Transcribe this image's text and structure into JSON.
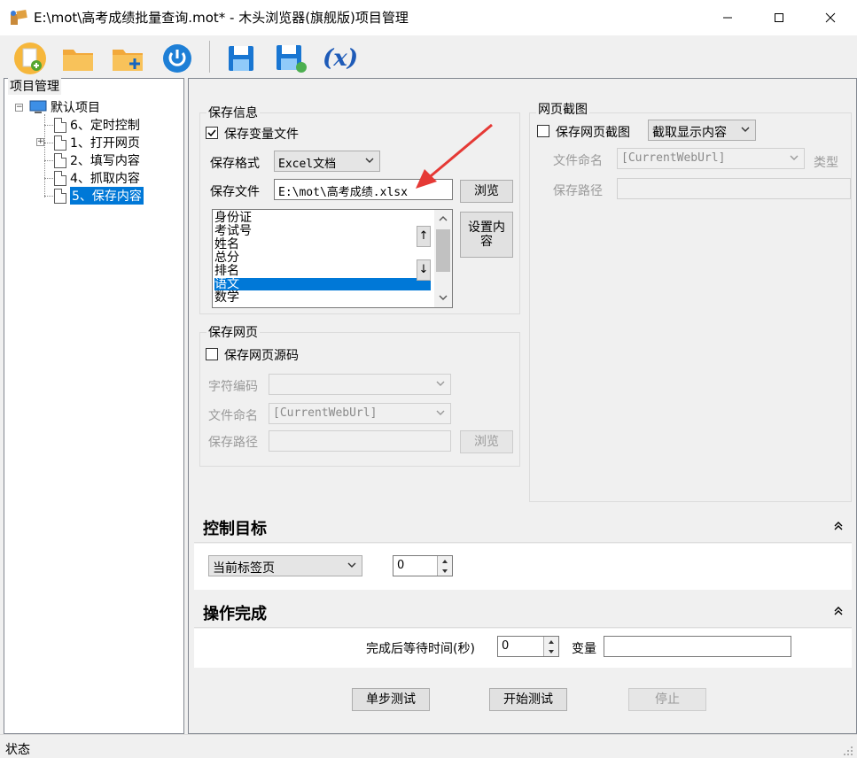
{
  "window": {
    "title": "E:\\mot\\高考成绩批量查询.mot* - 木头浏览器(旗舰版)项目管理"
  },
  "toolbar": {
    "icons": [
      "new-file-icon",
      "open-folder-icon",
      "add-folder-icon",
      "power-icon",
      "save-icon",
      "save-as-icon",
      "variable-icon"
    ],
    "variable_label": "(x)"
  },
  "left_panel": {
    "title": "项目管理",
    "tree": {
      "root": "默认项目",
      "items": [
        {
          "label": "6、定时控制",
          "selected": false,
          "expandable": false
        },
        {
          "label": "1、打开网页",
          "selected": false,
          "expandable": true
        },
        {
          "label": "2、填写内容",
          "selected": false,
          "expandable": false
        },
        {
          "label": "4、抓取内容",
          "selected": false,
          "expandable": false
        },
        {
          "label": "5、保存内容",
          "selected": true,
          "expandable": false
        }
      ]
    }
  },
  "save_info": {
    "group_title": "保存信息",
    "save_var_file_label": "保存变量文件",
    "save_var_file_checked": true,
    "format_label": "保存格式",
    "format_value": "Excel文档",
    "file_label": "保存文件",
    "file_value": "E:\\mot\\高考成绩.xlsx",
    "browse_label": "浏览",
    "set_content_label": "设置内容",
    "list_items": [
      "身份证",
      "考试号",
      "姓名",
      "总分",
      "排名",
      "语文",
      "数学"
    ],
    "list_selected_index": 5,
    "up_label": "↑",
    "down_label": "↓"
  },
  "save_webpage": {
    "group_title": "保存网页",
    "save_source_label": "保存网页源码",
    "save_source_checked": false,
    "encoding_label": "字符编码",
    "encoding_value": "",
    "naming_label": "文件命名",
    "naming_value": "[CurrentWebUrl]",
    "path_label": "保存路径",
    "path_value": "",
    "browse_label": "浏览"
  },
  "screenshot": {
    "group_title": "网页截图",
    "save_screenshot_label": "保存网页截图",
    "save_screenshot_checked": false,
    "mode_value": "截取显示内容",
    "naming_label": "文件命名",
    "naming_value": "[CurrentWebUrl]",
    "type_label": "类型",
    "path_label": "保存路径"
  },
  "control_target": {
    "title": "控制目标",
    "tab_value": "当前标签页",
    "index_value": "0"
  },
  "operation_done": {
    "title": "操作完成",
    "wait_label": "完成后等待时间(秒)",
    "wait_value": "0",
    "variable_label": "变量",
    "variable_value": ""
  },
  "actions": {
    "step_test": "单步测试",
    "start_test": "开始测试",
    "stop": "停止"
  },
  "status": {
    "text": "状态"
  },
  "colors": {
    "selection": "#0078d7",
    "accent_blue": "#1565c0",
    "disabled_text": "#9a9a9a"
  }
}
